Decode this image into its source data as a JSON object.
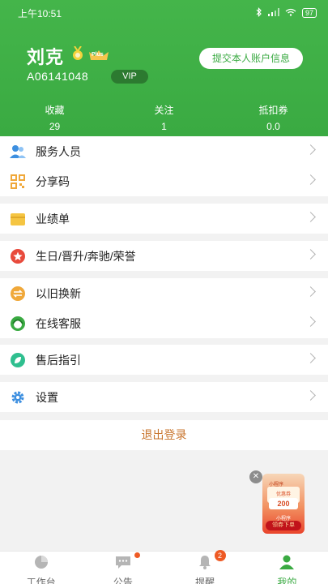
{
  "status_bar": {
    "time": "上午10:51",
    "battery": "97"
  },
  "profile": {
    "name": "刘克",
    "account_id": "A06141048",
    "vip_label": "VIP",
    "plus_label": "Plus",
    "submit_button": "提交本人账户信息"
  },
  "stats": [
    {
      "label": "收藏",
      "value": "29"
    },
    {
      "label": "关注",
      "value": "1"
    },
    {
      "label": "抵扣券",
      "value": "0.0"
    }
  ],
  "menu": {
    "service_staff": "服务人员",
    "share_code": "分享码",
    "performance": "业绩单",
    "birthday": "生日/晋升/奔驰/荣誉",
    "trade_in": "以旧换新",
    "online_service": "在线客服",
    "after_sales": "售后指引",
    "settings": "设置"
  },
  "logout": "退出登录",
  "promo": {
    "coupon_title": "小程序",
    "coupon_label": "优惠券",
    "amount": "200",
    "sub": "小程序",
    "cta": "领券下单"
  },
  "tabs": [
    {
      "label": "工作台",
      "icon": "pie-chart-icon"
    },
    {
      "label": "公告",
      "icon": "chat-icon"
    },
    {
      "label": "提醒",
      "icon": "bell-icon",
      "badge": "2"
    },
    {
      "label": "我的",
      "icon": "person-icon"
    }
  ],
  "colors": {
    "brand_green": "#3aaa42",
    "logout_orange": "#c8742c",
    "badge_red": "#ee5a24"
  }
}
